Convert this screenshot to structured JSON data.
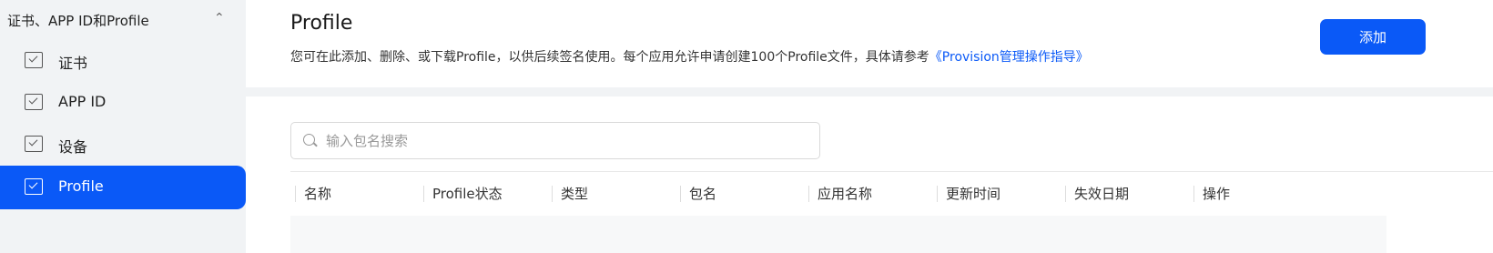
{
  "sidebar": {
    "group_label": "证书、APP ID和Profile",
    "items": [
      {
        "label": "证书"
      },
      {
        "label": "APP ID"
      },
      {
        "label": "设备"
      },
      {
        "label": "Profile"
      }
    ]
  },
  "header": {
    "title": "Profile",
    "description": "您可在此添加、删除、或下载Profile，以供后续签名使用。每个应用允许申请创建100个Profile文件，具体请参考",
    "link_text": "《Provision管理操作指导》",
    "add_label": "添加"
  },
  "search": {
    "placeholder": "输入包名搜索"
  },
  "table": {
    "columns": [
      "名称",
      "Profile状态",
      "类型",
      "包名",
      "应用名称",
      "更新时间",
      "失效日期",
      "操作"
    ]
  },
  "colors": {
    "accent": "#0a59f7",
    "background": "#f1f3f5"
  }
}
